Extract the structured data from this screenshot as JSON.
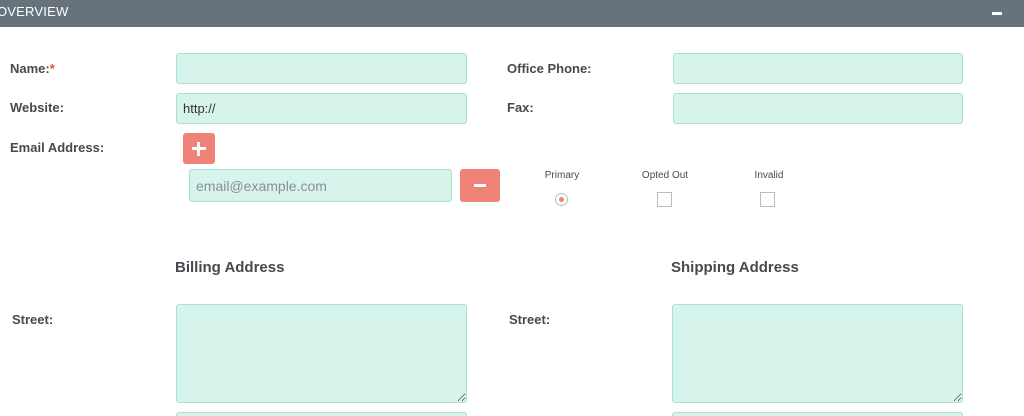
{
  "header": {
    "title": "OVERVIEW",
    "collapse_icon": "minus-icon"
  },
  "form": {
    "name_label": "Name:",
    "name_required_marker": "*",
    "name_value": "",
    "office_phone_label": "Office Phone:",
    "office_phone_value": "",
    "website_label": "Website:",
    "website_value": "http://",
    "fax_label": "Fax:",
    "fax_value": "",
    "email_label": "Email Address:",
    "email_placeholder": "email@example.com",
    "email_value": "",
    "email_options": {
      "primary_label": "Primary",
      "opted_out_label": "Opted Out",
      "invalid_label": "Invalid",
      "primary_selected": true,
      "opted_out_checked": false,
      "invalid_checked": false
    }
  },
  "billing": {
    "section_title": "Billing Address",
    "street_label": "Street:",
    "street_value": ""
  },
  "shipping": {
    "section_title": "Shipping Address",
    "street_label": "Street:",
    "street_value": ""
  },
  "colors": {
    "header_bg": "#66737c",
    "field_bg": "#d6f3ec",
    "field_border": "#a9e2d4",
    "accent_button": "#f08377",
    "required": "#e74c3c"
  }
}
